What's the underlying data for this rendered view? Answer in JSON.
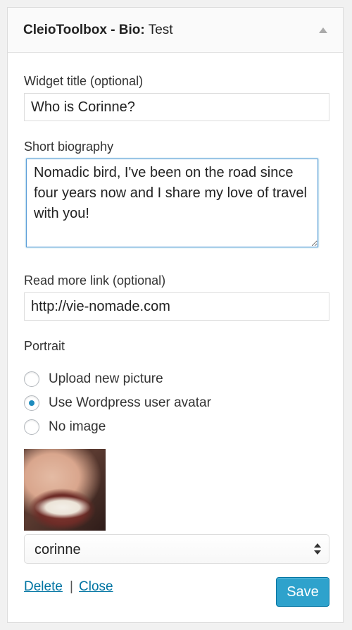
{
  "header": {
    "title_prefix": "CleioToolbox - Bio:",
    "title_suffix": "Test"
  },
  "form": {
    "widget_title": {
      "label": "Widget title (optional)",
      "value": "Who is Corinne?"
    },
    "biography": {
      "label": "Short biography",
      "value": "Nomadic bird, I've been on the road since four years now and I share my love of travel with you!"
    },
    "read_more": {
      "label": "Read more link (optional)",
      "value": "http://vie-nomade.com"
    },
    "portrait": {
      "label": "Portrait",
      "options": [
        {
          "label": "Upload new picture",
          "checked": false
        },
        {
          "label": "Use Wordpress user avatar",
          "checked": true
        },
        {
          "label": "No image",
          "checked": false
        }
      ],
      "user_select": "corinne"
    }
  },
  "actions": {
    "delete": "Delete",
    "separator": "|",
    "close": "Close",
    "save": "Save"
  },
  "colors": {
    "accent": "#2ea2cc",
    "link": "#0074a2",
    "focus_border": "#5b9dd9"
  }
}
